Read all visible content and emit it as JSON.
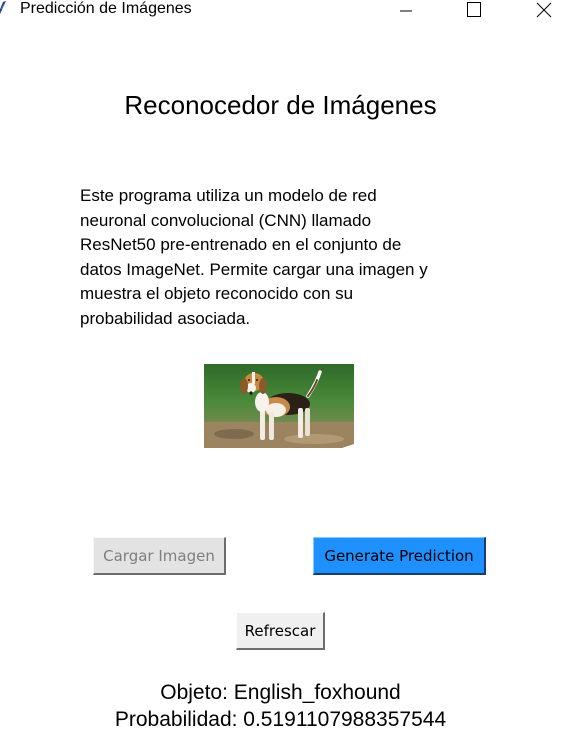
{
  "window": {
    "title": "Predicción de Imágenes"
  },
  "main": {
    "heading": "Reconocedor de Imágenes",
    "description_lines": [
      "Este programa utiliza un modelo de red",
      "neuronal convolucional (CNN) llamado",
      "ResNet50 pre-entrenado en el conjunto de",
      "datos ImageNet. Permite cargar una imagen y",
      "muestra el objeto reconocido con su",
      "probabilidad asociada."
    ],
    "buttons": {
      "load_label": "Cargar Imagen",
      "predict_label": "Generate Prediction",
      "refresh_label": "Refrescar"
    },
    "result": {
      "object_text": "Objeto: English_foxhound",
      "probability_text": "Probabilidad: 0.5191107988357544"
    }
  },
  "colors": {
    "predict_button_bg": "#1e90ff",
    "load_button_bg": "#e3e3e3",
    "load_button_text_disabled": "#7f7f7f",
    "refresh_button_bg": "#f0f0f0"
  },
  "icons": {
    "app": "feather-icon",
    "minimize": "minimize-icon",
    "maximize": "maximize-icon",
    "close": "close-icon",
    "photo": "beagle-dog-photo"
  }
}
